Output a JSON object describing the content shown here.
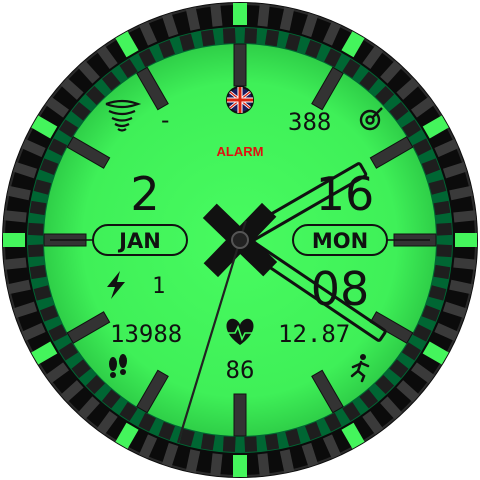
{
  "colors": {
    "face": "#44f55c",
    "bezel": "#0b0b0b",
    "accent": "#33ee55",
    "ink": "#111111",
    "alarm": "#e01010"
  },
  "top": {
    "weather_value": "-",
    "steps_goal_value": "388",
    "alarm_label": "ALARM"
  },
  "date": {
    "day": "2",
    "month": "JAN",
    "hour": "16",
    "weekday": "MON",
    "minute": "08"
  },
  "stats": {
    "battery_value": "1",
    "steps": "13988",
    "distance": "12.87",
    "heart_rate": "86"
  },
  "icons": {
    "weather": "tornado-icon",
    "flag": "union-jack-icon",
    "target": "target-icon",
    "battery": "lightning-bolt-icon",
    "heart": "heart-pulse-icon",
    "steps": "footprints-icon",
    "activity": "running-person-icon"
  },
  "hands": {
    "hour_angle_deg": 60,
    "minute_angle_deg": 124,
    "second_angle_deg": 197
  }
}
